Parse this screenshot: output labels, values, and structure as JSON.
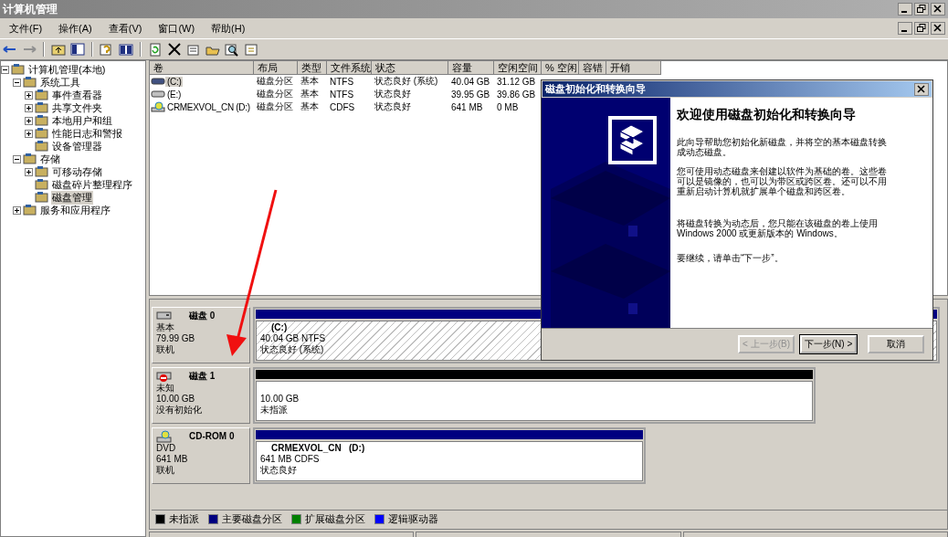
{
  "window": {
    "title": "计算机管理"
  },
  "menu": [
    "文件(F)",
    "操作(A)",
    "查看(V)",
    "窗口(W)",
    "帮助(H)"
  ],
  "tree": [
    {
      "label": "计算机管理(本地)",
      "selected": false,
      "expanded": true,
      "children": [
        {
          "label": "系统工具",
          "selected": false,
          "expanded": true,
          "children": [
            {
              "label": "事件查看器",
              "selected": false,
              "expanded": false
            },
            {
              "label": "共享文件夹",
              "selected": false,
              "expanded": false
            },
            {
              "label": "本地用户和组",
              "selected": false,
              "expanded": false
            },
            {
              "label": "性能日志和警报",
              "selected": false,
              "expanded": false
            },
            {
              "label": "设备管理器",
              "selected": false
            }
          ]
        },
        {
          "label": "存储",
          "selected": false,
          "expanded": true,
          "children": [
            {
              "label": "可移动存储",
              "selected": false,
              "expanded": false
            },
            {
              "label": "磁盘碎片整理程序",
              "selected": false
            },
            {
              "label": "磁盘管理",
              "selected": true
            }
          ]
        },
        {
          "label": "服务和应用程序",
          "selected": false,
          "expanded": false
        }
      ]
    }
  ],
  "volume_list": {
    "columns": [
      "卷",
      "布局",
      "类型",
      "文件系统",
      "状态",
      "容量",
      "空闲空间",
      "% 空闲",
      "容错",
      "开销"
    ],
    "rows": [
      {
        "kind": "hdd",
        "selected": true,
        "cells": [
          "(C:)",
          "磁盘分区",
          "基本",
          "NTFS",
          "状态良好 (系统)",
          "40.04 GB",
          "31.12 GB"
        ]
      },
      {
        "kind": "hdd",
        "selected": false,
        "cells": [
          "(E:)",
          "磁盘分区",
          "基本",
          "NTFS",
          "状态良好",
          "39.95 GB",
          "39.86 GB"
        ]
      },
      {
        "kind": "cdrom",
        "selected": false,
        "cells": [
          "CRMEXVOL_CN (D:)",
          "磁盘分区",
          "基本",
          "CDFS",
          "状态良好",
          "641 MB",
          "0 MB"
        ]
      }
    ]
  },
  "disks": [
    {
      "kind": "basic",
      "name": "磁盘 0",
      "type": "基本",
      "size": "79.99 GB",
      "status": "联机",
      "partitions": [
        {
          "kind": "primary",
          "selected": true,
          "label": "(C:)",
          "detail": "40.04 GB NTFS",
          "status": "状态良好 (系统)"
        }
      ]
    },
    {
      "kind": "unknown",
      "name": "磁盘 1",
      "type": "未知",
      "size": "10.00 GB",
      "status": "没有初始化",
      "partitions": [
        {
          "kind": "unallocated",
          "selected": false,
          "detail": "10.00 GB",
          "status": "未指派"
        }
      ]
    },
    {
      "kind": "cdrom",
      "name": "CD-ROM 0",
      "type": "DVD",
      "size": "641 MB",
      "status": "联机",
      "partitions": [
        {
          "kind": "primary",
          "selected": false,
          "label": "CRMEXVOL_CN   (D:)",
          "detail": "641 MB CDFS",
          "status": "状态良好"
        }
      ]
    }
  ],
  "legend": [
    {
      "label": "未指派",
      "color": "#000000"
    },
    {
      "label": "主要磁盘分区",
      "color": "#000080"
    },
    {
      "label": "扩展磁盘分区",
      "color": "#008000"
    },
    {
      "label": "逻辑驱动器",
      "color": "#0000ff"
    }
  ],
  "dialog": {
    "title": "磁盘初始化和转换向导",
    "heading": "欢迎使用磁盘初始化和转换向导",
    "paragraphs": [
      "此向导帮助您初始化新磁盘，并将空的基本磁盘转换成动态磁盘。",
      "您可使用动态磁盘来创建以软件为基础的卷。这些卷可以是镜像的，也可以为带区或跨区卷。还可以不用重新启动计算机就扩展单个磁盘和跨区卷。",
      "将磁盘转换为动态后，您只能在该磁盘的卷上使用 Windows 2000 或更新版本的 Windows。",
      "要继续，请单击“下一步”。"
    ],
    "buttons": [
      {
        "label": "< 上一步(B)",
        "disabled": true,
        "default": false
      },
      {
        "label": "下一步(N) >",
        "disabled": false,
        "default": true
      },
      {
        "label": "取消",
        "disabled": false,
        "default": false
      }
    ]
  }
}
